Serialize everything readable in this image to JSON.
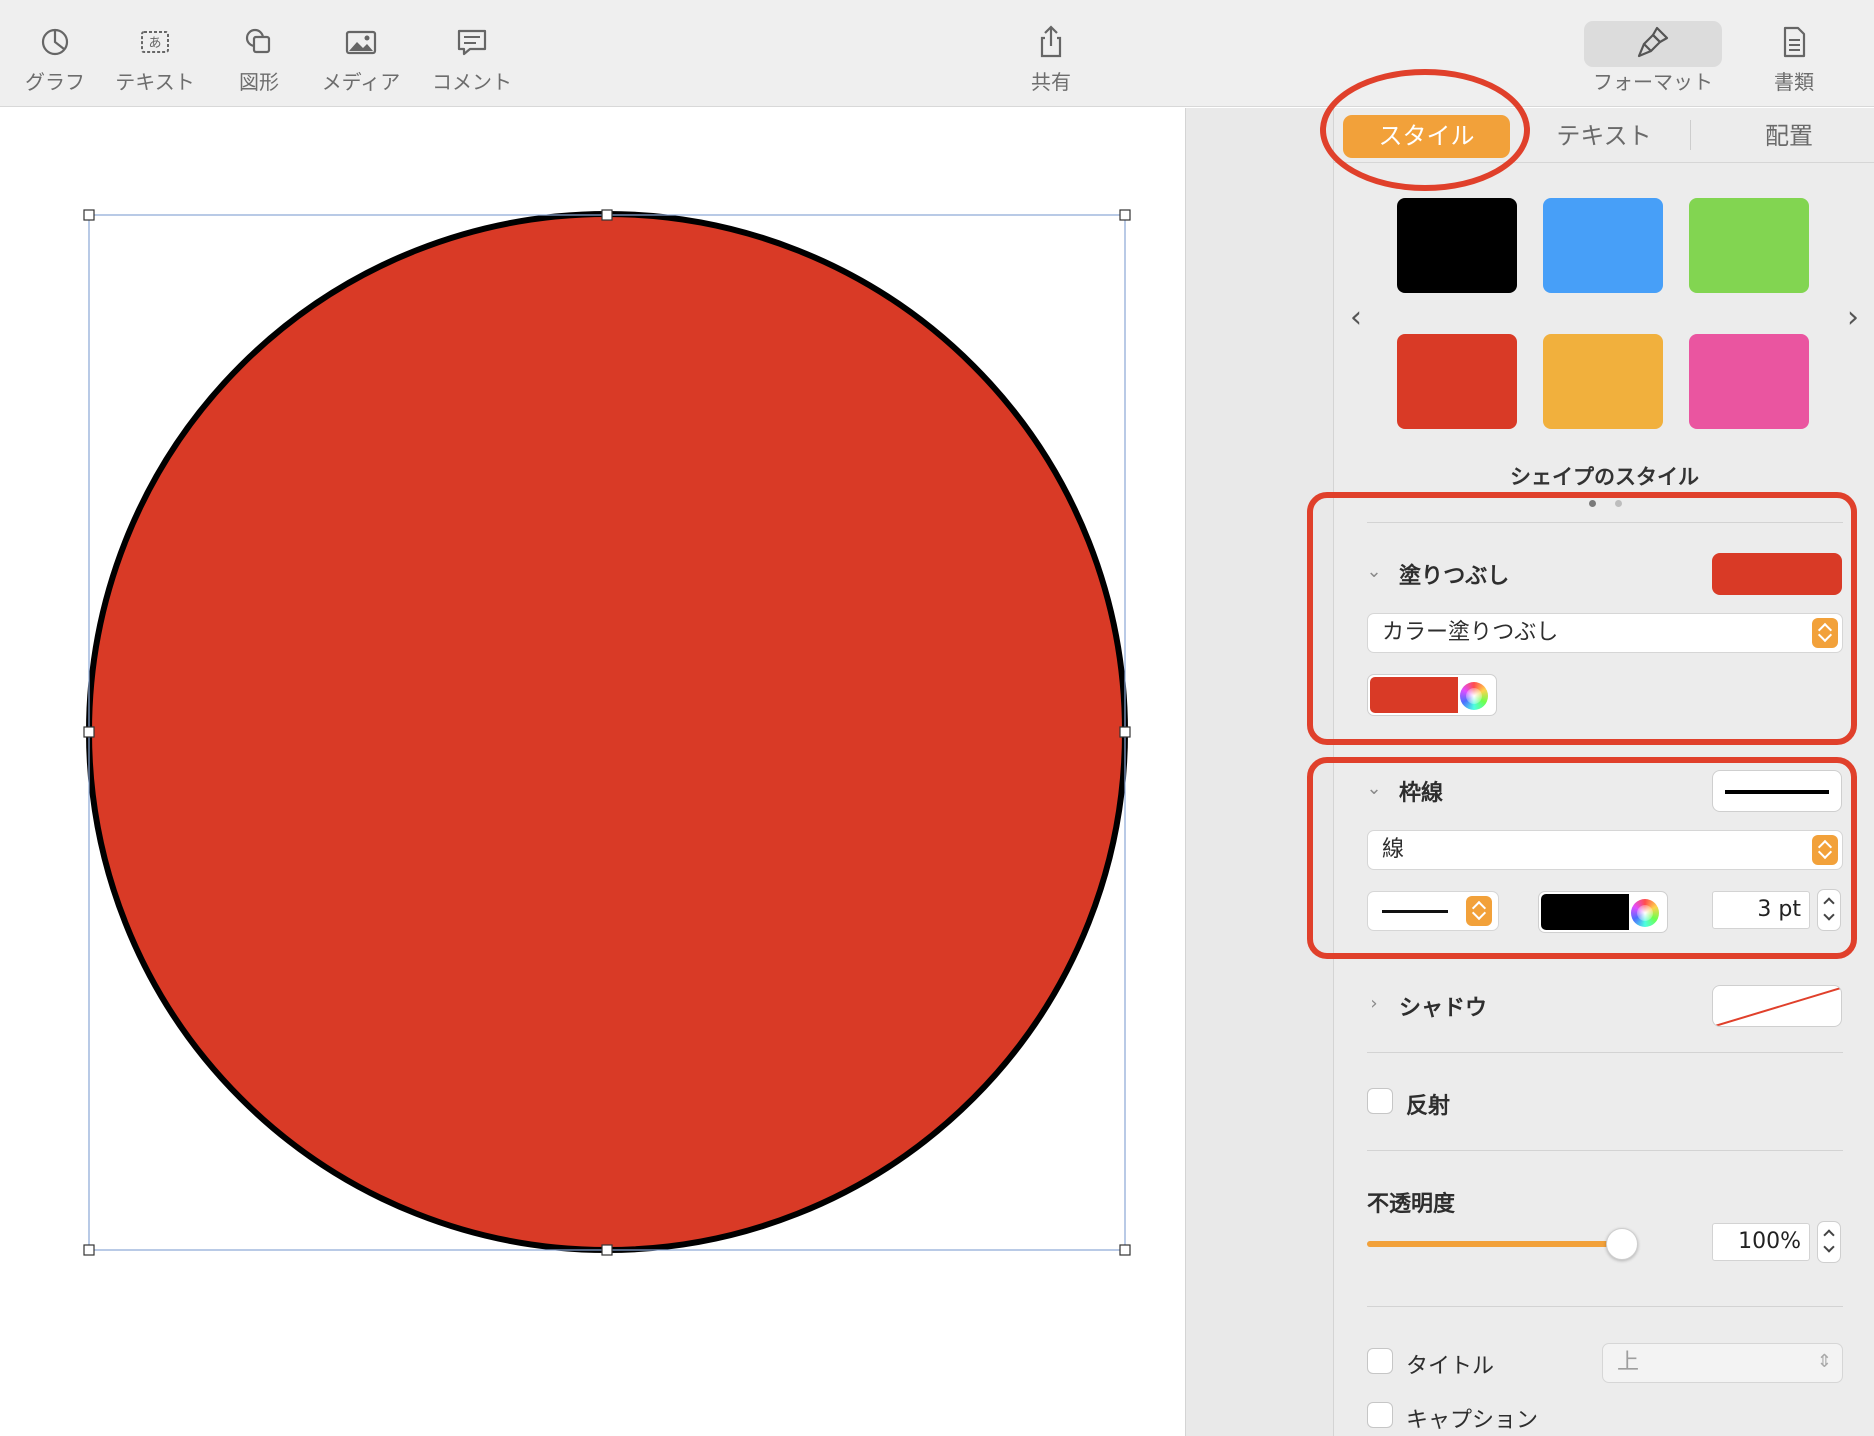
{
  "toolbar": {
    "items": [
      {
        "label": "グラフ",
        "icon": "chart-icon"
      },
      {
        "label": "テキスト",
        "icon": "text-box-icon"
      },
      {
        "label": "図形",
        "icon": "shape-icon"
      },
      {
        "label": "メディア",
        "icon": "media-icon"
      },
      {
        "label": "コメント",
        "icon": "comment-icon"
      }
    ],
    "share": {
      "label": "共有",
      "icon": "share-icon"
    },
    "format": {
      "label": "フォーマット",
      "icon": "paintbrush-icon"
    },
    "document": {
      "label": "書類",
      "icon": "document-icon"
    }
  },
  "canvas": {
    "shape_fill": "#d93a26",
    "shape_stroke": "#000000",
    "selection_color": "#8aa6d6"
  },
  "inspector": {
    "tabs": {
      "style": "スタイル",
      "text": "テキスト",
      "arrange": "配置"
    },
    "accent": "#f2a13a",
    "style_swatches": [
      "#000000",
      "#479ff8",
      "#82d551",
      "#d93a26",
      "#f1b03d",
      "#ea55a0"
    ],
    "style_caption": "シェイプのスタイル",
    "fill": {
      "title": "塗りつぶし",
      "preview_color": "#d93a26",
      "type": "カラー塗りつぶし",
      "color": "#d93a26"
    },
    "border": {
      "title": "枠線",
      "type": "線",
      "color": "#000000",
      "width": "3 pt"
    },
    "shadow": {
      "title": "シャドウ"
    },
    "reflection": {
      "label": "反射"
    },
    "opacity": {
      "title": "不透明度",
      "value": "100%",
      "level": 1.0
    },
    "title_checkbox": {
      "label": "タイトル",
      "position": "上"
    },
    "caption_checkbox": {
      "label": "キャプション"
    }
  },
  "annotation_color": "#e0402b"
}
